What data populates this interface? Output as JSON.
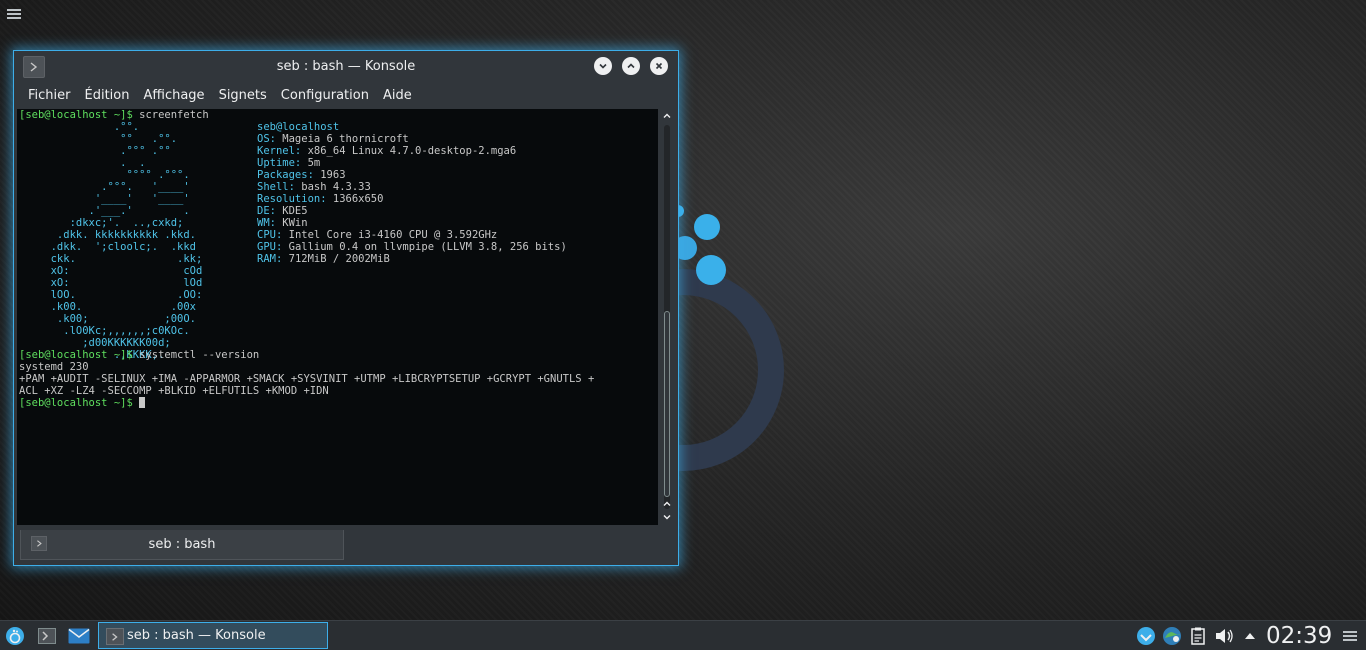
{
  "window": {
    "title": "seb : bash — Konsole",
    "menu": [
      "Fichier",
      "Édition",
      "Affichage",
      "Signets",
      "Configuration",
      "Aide"
    ],
    "tab_label": "seb : bash"
  },
  "terminal": {
    "prompt": "[seb@localhost ~]$",
    "command1": " screenfetch",
    "logo": [
      "               .°°.",
      "                °°   .°°.",
      "                .°°° .°°",
      "                .  .",
      "                 °°°° .°°°.",
      "             .°°°.   '____'",
      "            '____'   '____'",
      "           .'___.'        .",
      "        :dkxc;'.  ..,cxkd;",
      "      .dkk. kkkkkkkkkk .kkd.",
      "     .dkk.  ';cloolc;.  .kkd",
      "     ckk.                .kk;",
      "     xO:                  cOd",
      "     xO:                  lOd",
      "     lOO.                .OO:",
      "     .k00.              .00x",
      "      .k00;            ;00O.",
      "       .lO0Kc;,,,,,,;c0KOc.",
      "          ;d00KKKKKK00d;",
      "               .,KKKK,."
    ],
    "info_user": "seb@localhost",
    "info": [
      {
        "key": "OS:",
        "value": " Mageia 6 thornicroft"
      },
      {
        "key": "Kernel:",
        "value": " x86_64 Linux 4.7.0-desktop-2.mga6"
      },
      {
        "key": "Uptime:",
        "value": " 5m"
      },
      {
        "key": "Packages:",
        "value": " 1963"
      },
      {
        "key": "Shell:",
        "value": " bash 4.3.33"
      },
      {
        "key": "Resolution:",
        "value": " 1366x650"
      },
      {
        "key": "DE:",
        "value": " KDE5"
      },
      {
        "key": "WM:",
        "value": " KWin"
      },
      {
        "key": "CPU:",
        "value": " Intel Core i3-4160 CPU @ 3.592GHz"
      },
      {
        "key": "GPU:",
        "value": " Gallium 0.4 on llvmpipe (LLVM 3.8, 256 bits)"
      },
      {
        "key": "RAM:",
        "value": " 712MiB / 2002MiB"
      }
    ],
    "command2": " systemctl --version",
    "output": [
      "systemd 230",
      "+PAM +AUDIT -SELINUX +IMA -APPARMOR +SMACK +SYSVINIT +UTMP +LIBCRYPTSETUP +GCRYPT +GNUTLS +",
      "ACL +XZ -LZ4 -SECCOMP +BLKID +ELFUTILS +KMOD +IDN"
    ]
  },
  "taskbar": {
    "task_label": "seb : bash — Konsole",
    "clock": "02:39"
  },
  "colors": {
    "accent": "#3daee9",
    "prompt": "#5fdf5f",
    "logo": "#4fc3e8"
  }
}
